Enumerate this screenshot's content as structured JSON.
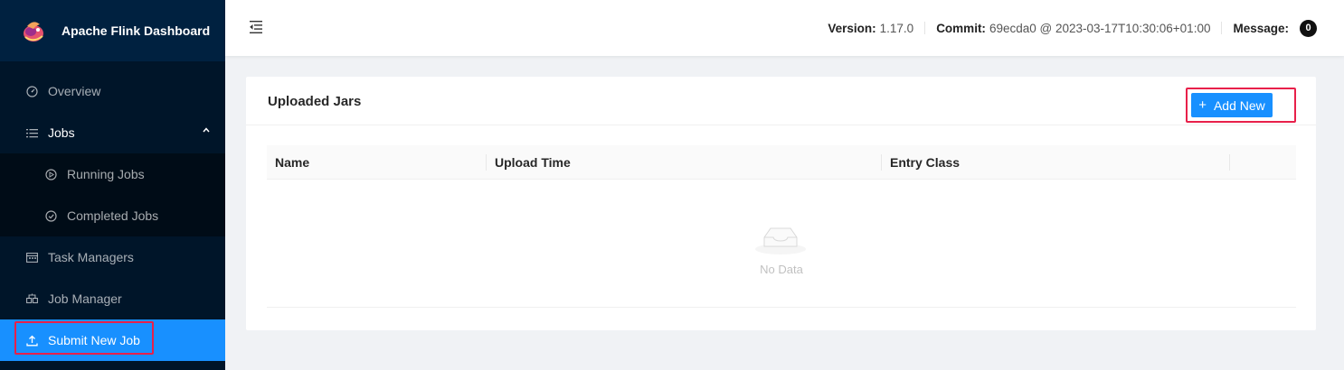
{
  "app": {
    "title": "Apache Flink Dashboard"
  },
  "sidebar": {
    "items": [
      {
        "label": "Overview",
        "icon": "dashboard-icon"
      },
      {
        "label": "Jobs",
        "icon": "list-icon",
        "expanded": true
      },
      {
        "label": "Running Jobs",
        "icon": "play-circle-icon"
      },
      {
        "label": "Completed Jobs",
        "icon": "check-circle-icon"
      },
      {
        "label": "Task Managers",
        "icon": "calendar-icon"
      },
      {
        "label": "Job Manager",
        "icon": "cluster-icon"
      },
      {
        "label": "Submit New Job",
        "icon": "upload-icon",
        "active": true
      }
    ]
  },
  "header": {
    "version_label": "Version:",
    "version_value": "1.17.0",
    "commit_label": "Commit:",
    "commit_value": "69ecda0 @ 2023-03-17T10:30:06+01:00",
    "message_label": "Message:",
    "message_count": "0"
  },
  "card": {
    "title": "Uploaded Jars",
    "add_button": "Add New",
    "columns": [
      "Name",
      "Upload Time",
      "Entry Class"
    ],
    "empty_text": "No Data"
  },
  "colors": {
    "sidebar_bg": "#001529",
    "primary": "#1890ff",
    "highlight": "#e8204a"
  }
}
